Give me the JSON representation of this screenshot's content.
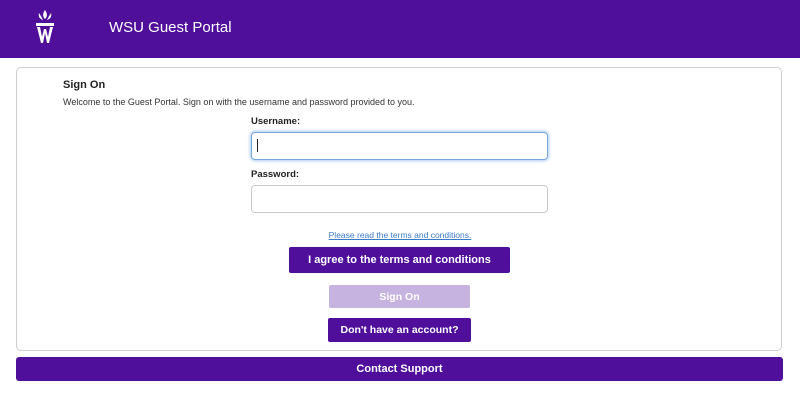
{
  "header": {
    "title": "WSU Guest Portal",
    "logo_icon": "wsu-logo-icon"
  },
  "colors": {
    "brand": "#4f0f9a",
    "brand_disabled": "#c6b3e0",
    "link": "#3b7ac9"
  },
  "signon": {
    "title": "Sign On",
    "welcome": "Welcome to the Guest Portal. Sign on with the username and password provided to you.",
    "username_label": "Username:",
    "username_value": "",
    "password_label": "Password:",
    "password_value": "",
    "terms_link": "Please read the terms and conditions.",
    "agree_button": "I agree to the terms and conditions",
    "signon_button": "Sign On",
    "account_button": "Don't have an account?"
  },
  "footer": {
    "support_button": "Contact Support"
  }
}
